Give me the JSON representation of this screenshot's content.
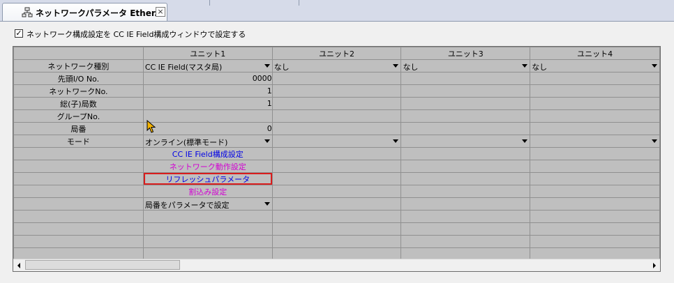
{
  "tab": {
    "title": "ネットワークパラメータ Ether...",
    "icon": "network-param-icon",
    "close_glyph": "×"
  },
  "option": {
    "checked": true,
    "check_glyph": "✓",
    "label": "ネットワーク構成設定を CC IE Field構成ウィンドウで設定する"
  },
  "columns": [
    "ユニット1",
    "ユニット2",
    "ユニット3",
    "ユニット4"
  ],
  "rows": {
    "network_type": {
      "label": "ネットワーク種別",
      "unit1": "CC IE Field(マスタ局)",
      "unit2": "なし",
      "unit3": "なし",
      "unit4": "なし"
    },
    "start_io": {
      "label": "先頭I/O No.",
      "unit1": "0000"
    },
    "network_no": {
      "label": "ネットワークNo.",
      "unit1": "1"
    },
    "total_stations": {
      "label": "総(子)局数",
      "unit1": "1"
    },
    "group_no": {
      "label": "グループNo.",
      "unit1": ""
    },
    "station_no": {
      "label": "局番",
      "unit1": "0"
    },
    "mode": {
      "label": "モード",
      "unit1": "オンライン(標準モード)"
    }
  },
  "buttons": {
    "cc_ie_config": "CC IE Field構成設定",
    "network_operation": "ネットワーク動作設定",
    "refresh_params": "リフレッシュパラメータ",
    "interrupt": "割込み設定"
  },
  "station_setting": "局番をパラメータで設定",
  "colors": {
    "link_blue": "#0000e6",
    "link_magenta": "#d200d2",
    "highlight_red": "#d91d1d"
  }
}
